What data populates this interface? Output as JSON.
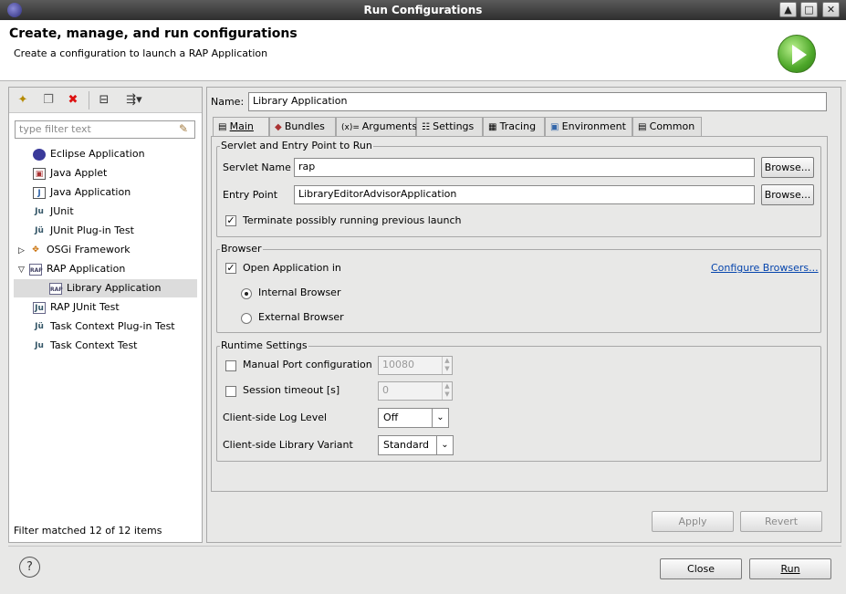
{
  "window": {
    "title": "Run Configurations"
  },
  "header": {
    "title": "Create, manage, and run configurations",
    "subtitle": "Create a configuration to launch a RAP Application"
  },
  "left": {
    "filter_placeholder": "type filter text",
    "tree": [
      {
        "label": "Eclipse Application",
        "icon": "eclipse-icon"
      },
      {
        "label": "Java Applet",
        "icon": "applet-icon"
      },
      {
        "label": "Java Application",
        "icon": "java-app-icon"
      },
      {
        "label": "JUnit",
        "icon": "junit-icon"
      },
      {
        "label": "JUnit Plug-in Test",
        "icon": "junit-plugin-icon"
      },
      {
        "label": "OSGi Framework",
        "icon": "osgi-icon"
      },
      {
        "label": "RAP Application",
        "icon": "rap-icon"
      },
      {
        "label": "Library Application",
        "icon": "rap-icon"
      },
      {
        "label": "RAP JUnit Test",
        "icon": "rap-junit-icon"
      },
      {
        "label": "Task Context Plug-in Test",
        "icon": "task-plugin-icon"
      },
      {
        "label": "Task Context Test",
        "icon": "task-test-icon"
      }
    ],
    "status": "Filter matched 12 of 12 items"
  },
  "form": {
    "name_label": "Name:",
    "name_value": "Library Application",
    "tabs": [
      "Main",
      "Bundles",
      "Arguments",
      "Settings",
      "Tracing",
      "Environment",
      "Common"
    ],
    "servlet_group": "Servlet and Entry Point to Run",
    "servlet_label": "Servlet Name",
    "servlet_value": "rap",
    "entry_label": "Entry Point",
    "entry_value": "LibraryEditorAdvisorApplication",
    "browse": "Browse...",
    "terminate": "Terminate possibly running previous launch",
    "browser_group": "Browser",
    "open_app": "Open Application in",
    "configure_browsers": "Configure Browsers...",
    "internal_browser": "Internal Browser",
    "external_browser": "External Browser",
    "runtime_group": "Runtime Settings",
    "manual_port": "Manual Port configuration",
    "port_value": "10080",
    "session_timeout": "Session timeout [s]",
    "timeout_value": "0",
    "log_level_label": "Client-side Log Level",
    "log_level_value": "Off",
    "variant_label": "Client-side Library Variant",
    "variant_value": "Standard",
    "apply": "Apply",
    "revert": "Revert"
  },
  "footer": {
    "close": "Close",
    "run": "Run"
  }
}
